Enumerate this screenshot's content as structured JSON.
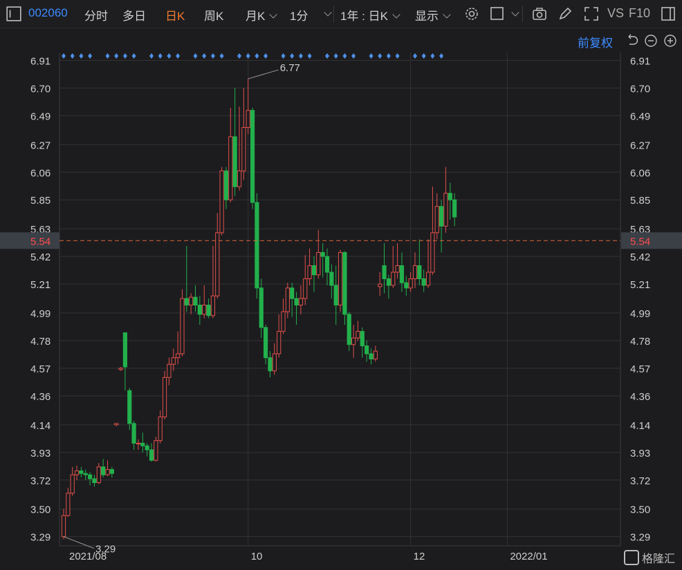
{
  "toolbar": {
    "code": "002060",
    "tabs": [
      {
        "label": "分时",
        "active": false
      },
      {
        "label": "多日",
        "active": false
      },
      {
        "label": "日K",
        "active": true
      },
      {
        "label": "周K",
        "active": false
      },
      {
        "label": "月K",
        "active": false
      }
    ],
    "interval": "1分",
    "range": "1年 : 日K",
    "display": "显示",
    "vs": "VS",
    "f10": "F10"
  },
  "subbar": {
    "adjust": "前复权"
  },
  "watermark": "格隆汇",
  "colors": {
    "up": "#e5504c",
    "down": "#22b14c",
    "marker": "#4f8fe6",
    "ref": "#e0663a",
    "grid": "#333336"
  },
  "chart_data": {
    "type": "candlestick",
    "y_ticks": [
      "6.91",
      "6.70",
      "6.49",
      "6.27",
      "6.06",
      "5.85",
      "5.63",
      "5.42",
      "5.21",
      "4.99",
      "4.78",
      "4.57",
      "4.36",
      "4.14",
      "3.93",
      "3.72",
      "3.50",
      "3.29"
    ],
    "ylim": [
      3.22,
      6.97
    ],
    "x_labels": [
      {
        "label": "2021/08",
        "index": 0
      },
      {
        "label": "10",
        "index": 42
      },
      {
        "label": "12",
        "index": 79
      },
      {
        "label": "2022/01",
        "index": 101
      }
    ],
    "ref_price": "5.54",
    "annotations": [
      {
        "label": "6.77",
        "index": 42,
        "value": 6.77
      },
      {
        "label": "3.29",
        "index": 0,
        "value": 3.29
      }
    ],
    "candles": [
      [
        3.29,
        3.45,
        3.5,
        3.27
      ],
      [
        3.45,
        3.62,
        3.66,
        3.44
      ],
      [
        3.62,
        3.76,
        3.82,
        3.6
      ],
      [
        3.76,
        3.79,
        3.83,
        3.72
      ],
      [
        3.79,
        3.77,
        3.82,
        3.74
      ],
      [
        3.77,
        3.76,
        3.8,
        3.72
      ],
      [
        3.76,
        3.73,
        3.78,
        3.68
      ],
      [
        3.73,
        3.7,
        3.76,
        3.67
      ],
      [
        3.7,
        3.82,
        3.85,
        3.69
      ],
      [
        3.82,
        3.76,
        3.88,
        3.74
      ],
      [
        3.76,
        3.8,
        3.87,
        3.75
      ],
      [
        3.8,
        3.77,
        3.82,
        3.74
      ],
      [
        4.14,
        4.15,
        4.15,
        4.13
      ],
      [
        4.56,
        4.57,
        4.58,
        4.55
      ],
      [
        4.84,
        4.58,
        4.84,
        4.4
      ],
      [
        4.4,
        4.15,
        4.42,
        4.1
      ],
      [
        4.15,
        4.0,
        4.17,
        3.95
      ],
      [
        4.0,
        4.0,
        4.03,
        3.95
      ],
      [
        4.0,
        3.98,
        4.08,
        3.93
      ],
      [
        3.98,
        3.95,
        4.0,
        3.9
      ],
      [
        3.95,
        3.87,
        4.0,
        3.86
      ],
      [
        3.87,
        4.02,
        4.05,
        3.86
      ],
      [
        4.02,
        4.2,
        4.25,
        4.0
      ],
      [
        4.2,
        4.5,
        4.55,
        4.18
      ],
      [
        4.5,
        4.6,
        4.65,
        4.44
      ],
      [
        4.6,
        4.65,
        4.72,
        4.55
      ],
      [
        4.65,
        4.68,
        4.85,
        4.6
      ],
      [
        4.68,
        5.1,
        5.17,
        4.66
      ],
      [
        5.1,
        5.05,
        5.5,
        5.0
      ],
      [
        5.05,
        5.11,
        5.14,
        4.98
      ],
      [
        5.11,
        5.05,
        5.2,
        5.0
      ],
      [
        5.05,
        4.98,
        5.12,
        4.9
      ],
      [
        4.98,
        5.05,
        5.2,
        4.95
      ],
      [
        5.05,
        4.97,
        5.1,
        4.95
      ],
      [
        4.97,
        5.12,
        5.5,
        4.95
      ],
      [
        5.12,
        5.6,
        5.75,
        5.1
      ],
      [
        5.6,
        6.07,
        6.1,
        5.58
      ],
      [
        6.07,
        5.85,
        6.1,
        5.78
      ],
      [
        5.85,
        6.33,
        6.55,
        5.83
      ],
      [
        6.33,
        5.95,
        6.7,
        5.88
      ],
      [
        5.95,
        6.07,
        6.56,
        5.92
      ],
      [
        6.07,
        6.4,
        6.7,
        6.0
      ],
      [
        6.4,
        6.53,
        6.77,
        6.35
      ],
      [
        6.53,
        5.83,
        6.55,
        5.78
      ],
      [
        5.83,
        5.18,
        5.9,
        5.1
      ],
      [
        5.18,
        4.88,
        5.25,
        4.8
      ],
      [
        4.88,
        4.65,
        4.9,
        4.6
      ],
      [
        4.65,
        4.55,
        4.7,
        4.5
      ],
      [
        4.55,
        4.68,
        4.76,
        4.52
      ],
      [
        4.68,
        4.85,
        4.98,
        4.65
      ],
      [
        4.85,
        5.0,
        5.1,
        4.83
      ],
      [
        5.0,
        5.18,
        5.22,
        4.95
      ],
      [
        5.18,
        5.1,
        5.22,
        4.96
      ],
      [
        5.1,
        5.05,
        5.15,
        4.9
      ],
      [
        5.05,
        5.1,
        5.2,
        4.98
      ],
      [
        5.1,
        5.25,
        5.43,
        5.05
      ],
      [
        5.25,
        5.35,
        5.48,
        5.2
      ],
      [
        5.35,
        5.28,
        5.42,
        5.15
      ],
      [
        5.28,
        5.45,
        5.62,
        5.25
      ],
      [
        5.45,
        5.42,
        5.52,
        5.26
      ],
      [
        5.42,
        5.3,
        5.48,
        5.2
      ],
      [
        5.3,
        5.2,
        5.36,
        5.1
      ],
      [
        5.2,
        5.05,
        5.35,
        4.9
      ],
      [
        5.05,
        5.45,
        5.47,
        5.0
      ],
      [
        5.45,
        4.98,
        5.46,
        4.9
      ],
      [
        4.98,
        4.75,
        5.0,
        4.7
      ],
      [
        4.75,
        4.8,
        4.9,
        4.65
      ],
      [
        4.8,
        4.85,
        4.93,
        4.78
      ],
      [
        4.85,
        4.74,
        4.88,
        4.65
      ],
      [
        4.74,
        4.68,
        4.78,
        4.62
      ],
      [
        4.68,
        4.64,
        4.72,
        4.6
      ],
      [
        4.64,
        4.7,
        4.74,
        4.62
      ],
      [
        5.19,
        5.21,
        5.3,
        5.12
      ],
      [
        5.35,
        5.25,
        5.52,
        5.14
      ],
      [
        5.25,
        5.2,
        5.28,
        5.1
      ],
      [
        5.2,
        5.3,
        5.5,
        5.18
      ],
      [
        5.3,
        5.35,
        5.52,
        5.25
      ],
      [
        5.35,
        5.22,
        5.45,
        5.15
      ],
      [
        5.22,
        5.18,
        5.27,
        5.12
      ],
      [
        5.18,
        5.25,
        5.3,
        5.15
      ],
      [
        5.25,
        5.35,
        5.45,
        5.18
      ],
      [
        5.35,
        5.25,
        5.55,
        5.2
      ],
      [
        5.25,
        5.2,
        5.32,
        5.15
      ],
      [
        5.2,
        5.3,
        5.55,
        5.18
      ],
      [
        5.3,
        5.6,
        5.95,
        5.28
      ],
      [
        5.6,
        5.8,
        5.9,
        5.55
      ],
      [
        5.8,
        5.65,
        5.85,
        5.45
      ],
      [
        5.65,
        5.9,
        6.1,
        5.6
      ],
      [
        5.9,
        5.85,
        5.98,
        5.7
      ],
      [
        5.85,
        5.72,
        5.9,
        5.65
      ]
    ]
  }
}
